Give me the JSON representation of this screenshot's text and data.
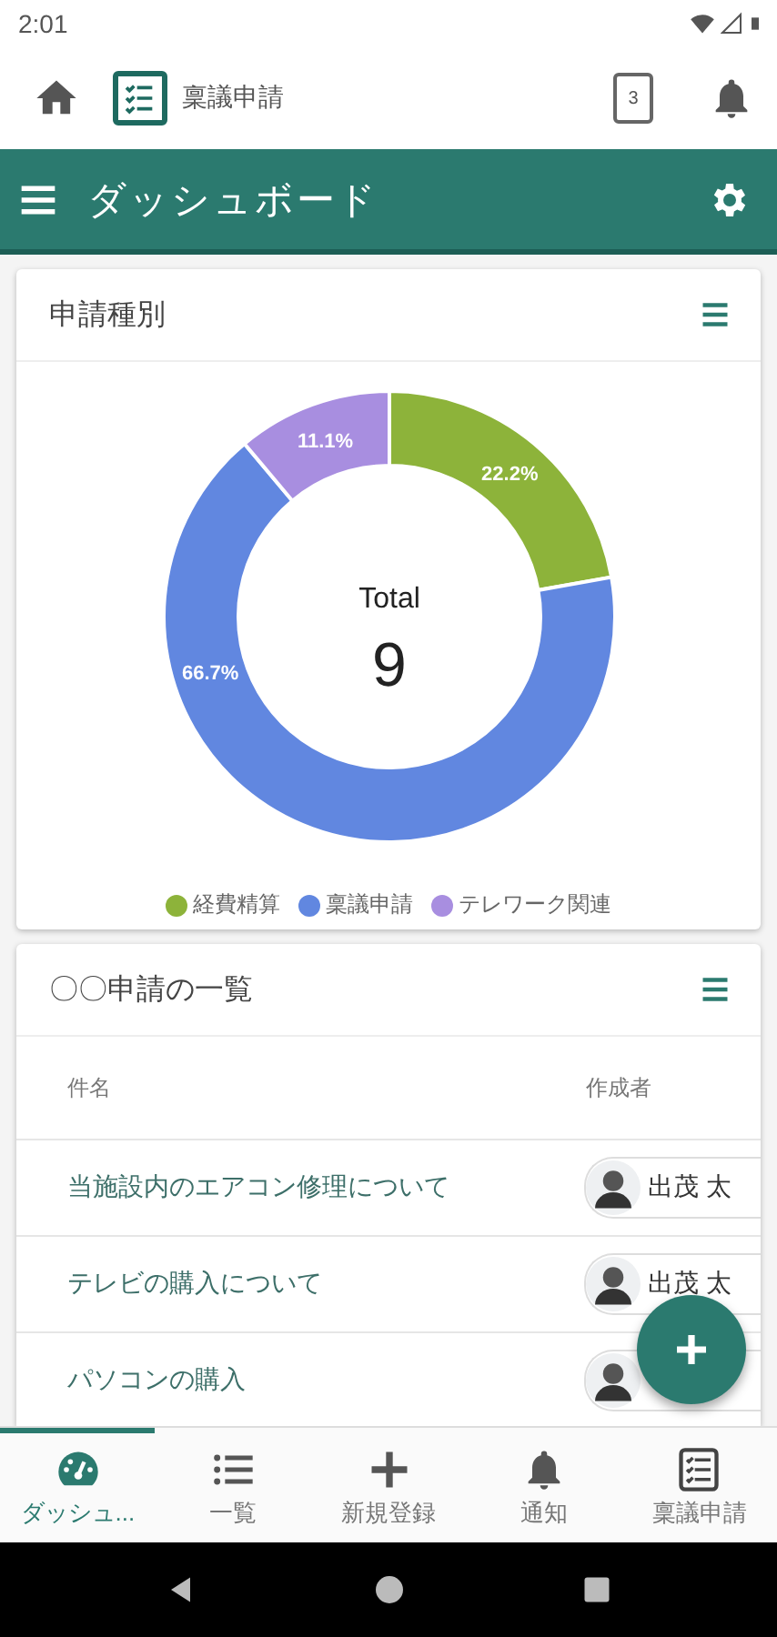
{
  "status_bar": {
    "time": "2:01"
  },
  "app_header": {
    "app_name": "稟議申請",
    "badge": "3"
  },
  "title_bar": {
    "title": "ダッシュボード"
  },
  "chart_card": {
    "title": "申請種別",
    "center_label": "Total",
    "center_value": "9",
    "chart_data": {
      "type": "donut",
      "values": [
        22.2,
        66.7,
        11.1
      ],
      "value_labels": [
        "22.2%",
        "66.7%",
        "11.1%"
      ]
    },
    "legend": [
      {
        "label": "経費精算",
        "color": "#8db33a"
      },
      {
        "label": "稟議申請",
        "color": "#6187e0"
      },
      {
        "label": "テレワーク関連",
        "color": "#a88ee0"
      }
    ]
  },
  "list_card": {
    "title": "〇〇申請の一覧",
    "columns": [
      "件名",
      "作成者"
    ],
    "rows": [
      {
        "subject": "当施設内のエアコン修理について",
        "author": "出茂 太"
      },
      {
        "subject": "テレビの購入について",
        "author": "出茂 太"
      },
      {
        "subject": "パソコンの購入"
      }
    ]
  },
  "bottom_nav": [
    {
      "label": "ダッシュ...",
      "selected": true
    },
    {
      "label": "一覧",
      "selected": false
    },
    {
      "label": "新規登録",
      "selected": false
    },
    {
      "label": "通知",
      "selected": false
    },
    {
      "label": "稟議申請",
      "selected": false
    }
  ]
}
